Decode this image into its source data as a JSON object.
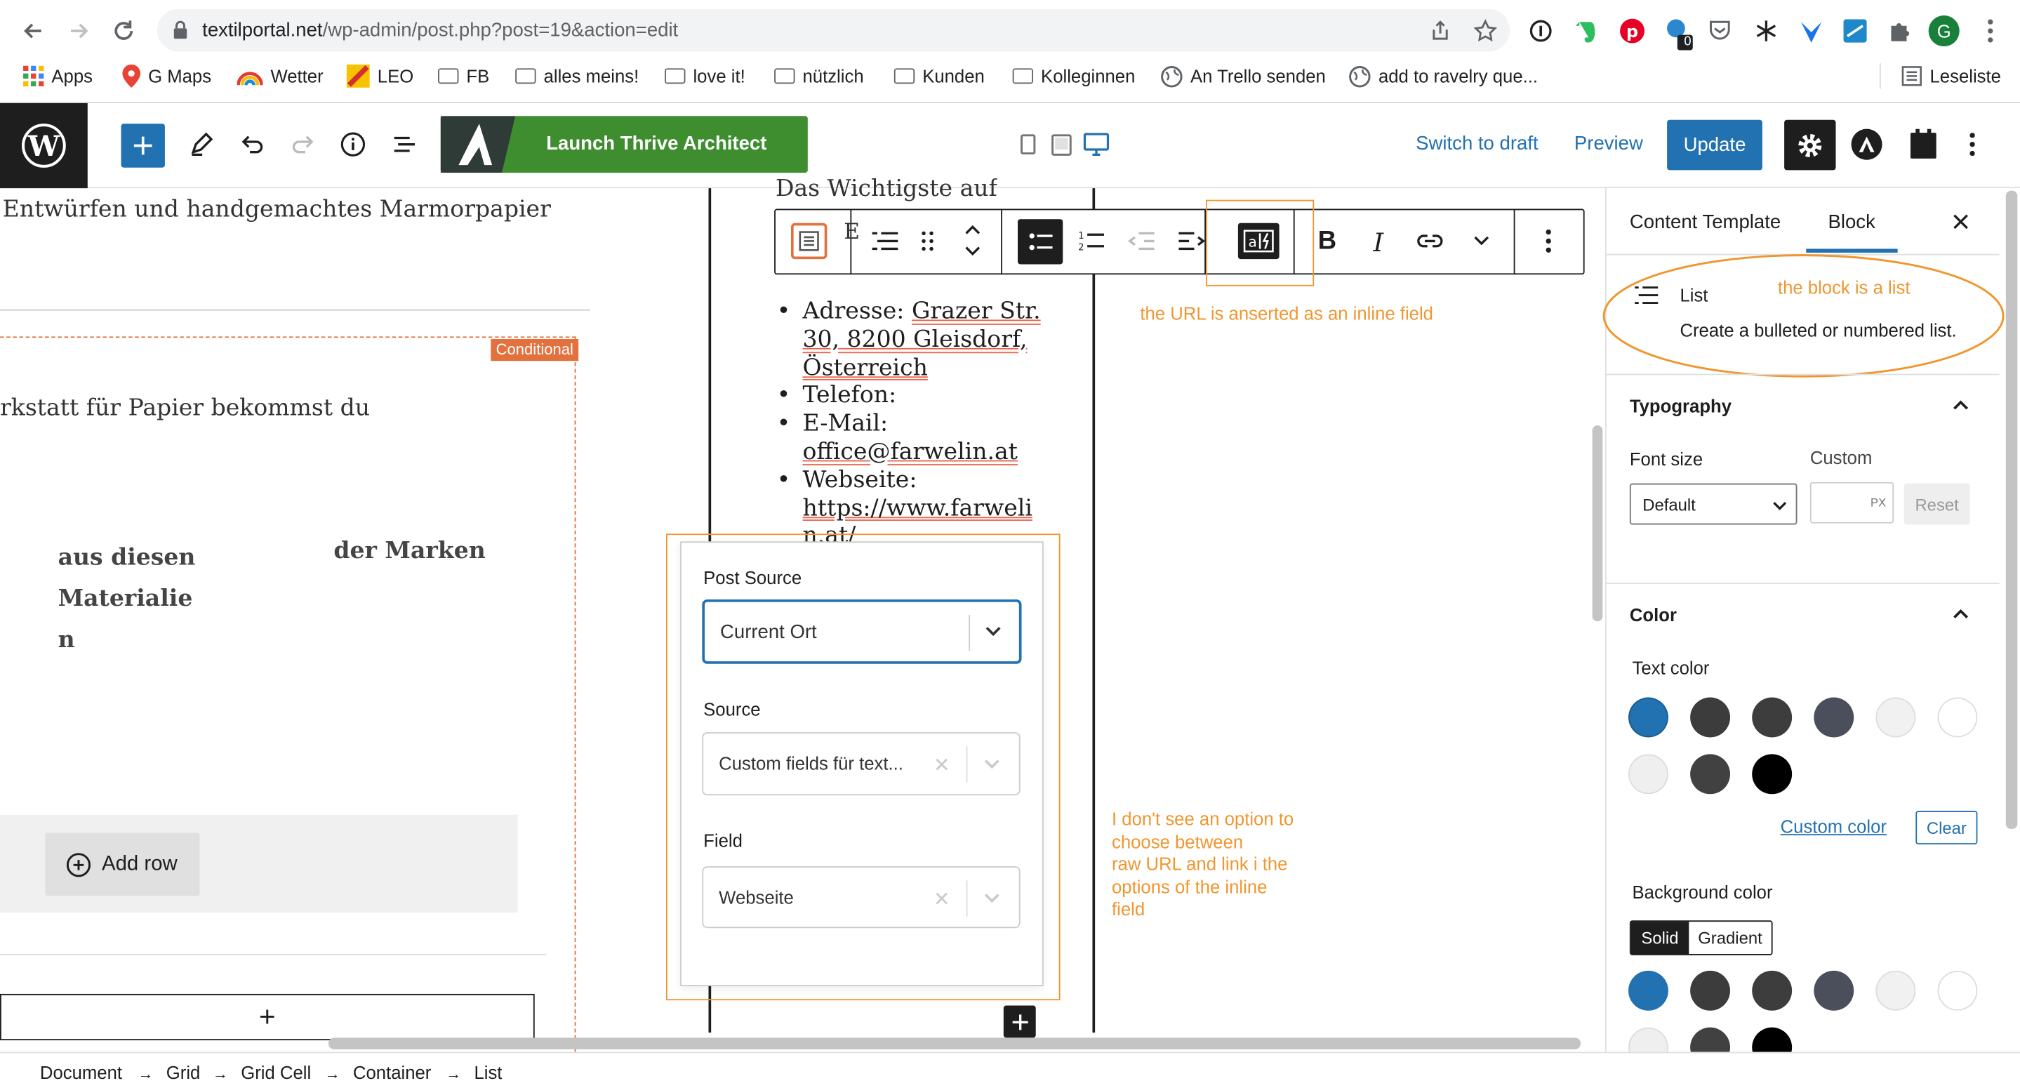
{
  "browser": {
    "url_domain": "textilportal.net",
    "url_path": "/wp-admin/post.php?post=19&action=edit",
    "avatar_letter": "G",
    "badge_count": "0",
    "bookmarks": [
      "Apps",
      "G Maps",
      "Wetter",
      "LEO",
      "FB",
      "alles meins!",
      "love it!",
      "nützlich",
      "Kunden",
      "Kolleginnen",
      "An Trello senden",
      "add to ravelry que..."
    ],
    "reading_list": "Leseliste"
  },
  "toolbar": {
    "thrive_label": "Launch Thrive Architect",
    "switch_draft": "Switch to draft",
    "preview": "Preview",
    "update": "Update"
  },
  "canvas": {
    "heading_text": "Entwürfen und handgemachtes Marmorpapier",
    "conditional_label": "Conditional",
    "body_text": "rkstatt für Papier bekommst du",
    "col1_line1": "aus diesen",
    "col1_line2": "Materialie",
    "col1_line3": "n",
    "col2_line1": "der Marken",
    "add_row": "Add row",
    "plus": "+",
    "mid_heading": "Das Wichtigste auf",
    "mid_hidden_char": "E"
  },
  "list": {
    "item1_label": "Adresse: ",
    "item1_value1": "Grazer Str.",
    "item1_value2": "30, 8200 Gleisdorf,",
    "item1_value3": "Österreich",
    "item2": "Telefon:",
    "item3": "E-Mail:",
    "item3_value": "office@farwelin.at",
    "item4": "Webseite:",
    "item4_value1": "https://www.farweli",
    "item4_value2": "n.at/"
  },
  "inline_field": {
    "post_source_label": "Post Source",
    "post_source_value": "Current Ort",
    "source_label": "Source",
    "source_value": "Custom fields für text...",
    "field_label": "Field",
    "field_value": "Webseite"
  },
  "annotations": {
    "url_inline": "the URL is anserted as an inline field",
    "block_is_list": "the block is a list",
    "note_line1": "I don't see an option to",
    "note_line2": "choose between",
    "note_line3": "raw URL and link i the",
    "note_line4": "options of the inline",
    "note_line5": "field"
  },
  "sidebar": {
    "tab_template": "Content Template",
    "tab_block": "Block",
    "block_name": "List",
    "block_desc": "Create a bulleted or numbered list.",
    "typography_title": "Typography",
    "font_size_label": "Font size",
    "custom_label": "Custom",
    "font_size_value": "Default",
    "px_unit": "PX",
    "reset": "Reset",
    "color_title": "Color",
    "text_color_label": "Text color",
    "custom_color": "Custom color",
    "clear": "Clear",
    "bg_color_label": "Background color",
    "solid": "Solid",
    "gradient": "Gradient",
    "colors": {
      "blue": "#2271b1",
      "dark1": "#3c3c3c",
      "dark2": "#3d3d3d",
      "slate": "#4b4f5c",
      "light1": "#f1f1f1",
      "white": "#ffffff",
      "light2": "#efefef",
      "dark3": "#414141",
      "black": "#000000"
    }
  },
  "breadcrumb": [
    "Document",
    "Grid",
    "Grid Cell",
    "Container",
    "List"
  ],
  "accent": {
    "wp_blue": "#2271b1",
    "thrive_green": "#3e8e2f",
    "annotation_orange": "#f0962f",
    "conditional_orange": "#e2713d"
  }
}
